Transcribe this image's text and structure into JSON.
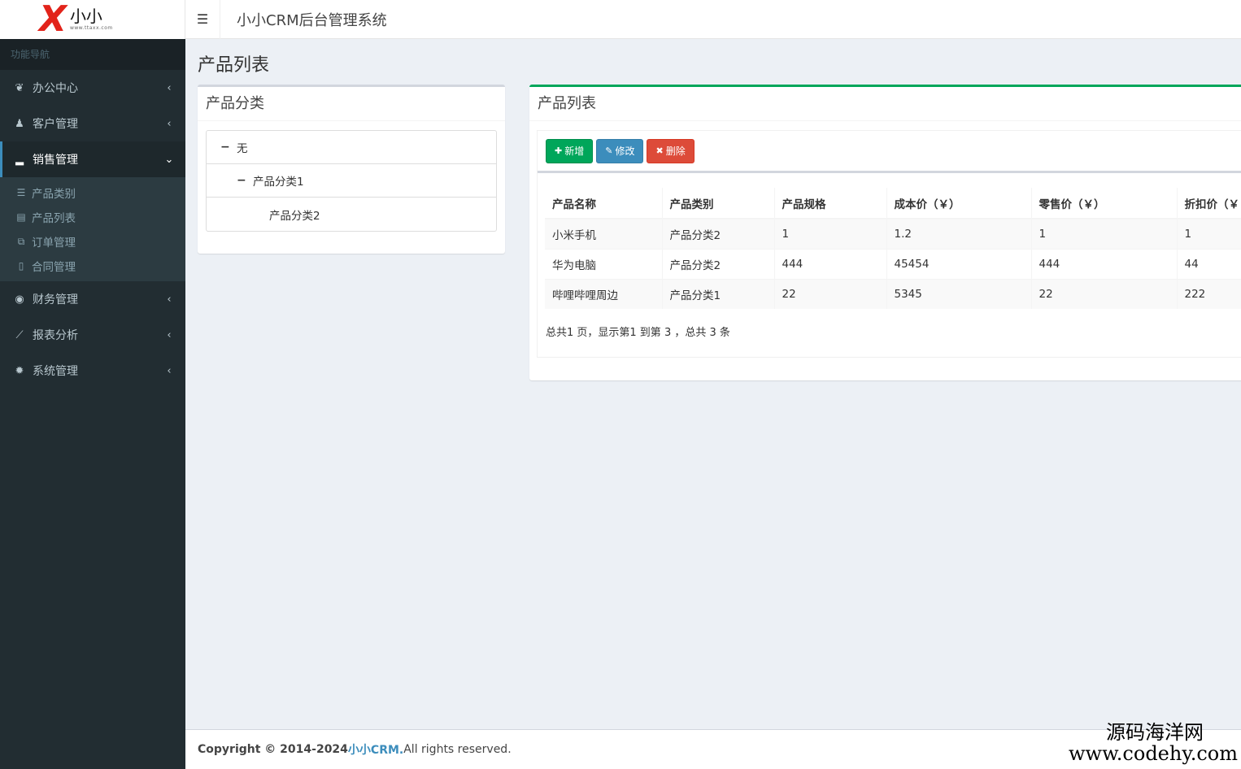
{
  "logo": {
    "mark": "X",
    "name": "小小",
    "url": "www.ttaxx.com"
  },
  "header": {
    "app_title": "小小CRM后台管理系统",
    "toggle_icon": "bars-icon"
  },
  "sidebar": {
    "nav_header": "功能导航",
    "items": [
      {
        "label": "办公中心",
        "icon": "leaf-icon",
        "arrow": "‹"
      },
      {
        "label": "客户管理",
        "icon": "person-icon",
        "arrow": "‹"
      },
      {
        "label": "销售管理",
        "icon": "signal-icon",
        "arrow": "⌄"
      },
      {
        "label": "财务管理",
        "icon": "eye-icon",
        "arrow": "‹"
      },
      {
        "label": "报表分析",
        "icon": "line-chart-icon",
        "arrow": "‹"
      },
      {
        "label": "系统管理",
        "icon": "gear-icon",
        "arrow": "‹"
      }
    ],
    "sub_items": [
      {
        "label": "产品类别",
        "icon": "list-icon"
      },
      {
        "label": "产品列表",
        "icon": "list-alt-icon"
      },
      {
        "label": "订单管理",
        "icon": "copy-icon"
      },
      {
        "label": "合同管理",
        "icon": "file-icon"
      }
    ]
  },
  "page": {
    "title": "产品列表"
  },
  "category_box": {
    "title": "产品分类",
    "tree": [
      {
        "label": "无",
        "toggle": "−",
        "level": 0
      },
      {
        "label": "产品分类1",
        "toggle": "−",
        "level": 1
      },
      {
        "label": "产品分类2",
        "toggle": "",
        "level": 2
      }
    ]
  },
  "product_box": {
    "title": "产品列表",
    "buttons": {
      "add": "新增",
      "edit": "修改",
      "delete": "删除"
    },
    "columns": [
      "产品名称",
      "产品类别",
      "产品规格",
      "成本价（￥）",
      "零售价（￥）",
      "折扣价（￥"
    ],
    "rows": [
      [
        "小米手机",
        "产品分类2",
        "1",
        "1.2",
        "1",
        "1"
      ],
      [
        "华为电脑",
        "产品分类2",
        "444",
        "45454",
        "444",
        "44"
      ],
      [
        "哔哩哔哩周边",
        "产品分类1",
        "22",
        "5345",
        "22",
        "222"
      ]
    ],
    "pager": "总共1 页，显示第1 到第 3 ，总共 3 条"
  },
  "footer": {
    "copyright": "Copyright © 2014-2024 ",
    "brand": "小小CRM.",
    "rights": " All rights reserved."
  },
  "watermark": {
    "line1": "源码海洋网",
    "line2": "www.codehy.com"
  },
  "colors": {
    "sidebar": "#222d32",
    "accent": "#3c8dbc",
    "success": "#00a65a",
    "danger": "#dd4b39"
  }
}
